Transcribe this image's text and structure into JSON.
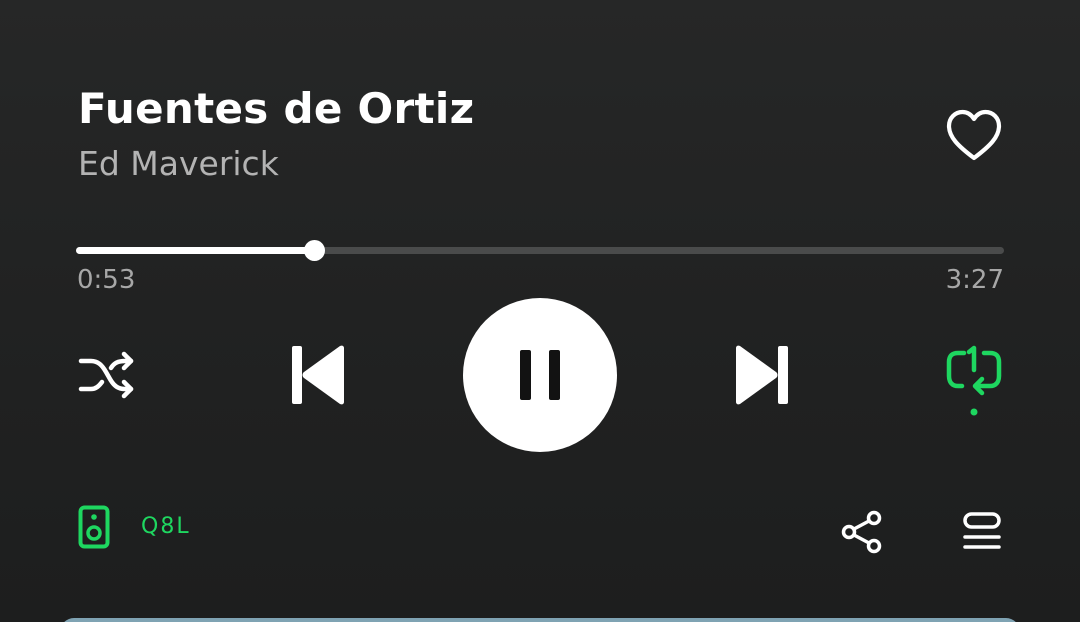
{
  "track": {
    "title": "Fuentes de Ortiz",
    "artist": "Ed Maverick",
    "liked": false
  },
  "progress": {
    "elapsed": "0:53",
    "total": "3:27",
    "fraction": 0.256
  },
  "controls": {
    "shuffle_icon": "shuffle-icon",
    "previous_icon": "skip-previous-icon",
    "play_state_icon": "pause-icon",
    "next_icon": "skip-next-icon",
    "repeat_icon": "repeat-one-icon",
    "repeat_mode": "one"
  },
  "device": {
    "icon": "speaker-icon",
    "name": "Q8L"
  },
  "actions": {
    "share_icon": "share-icon",
    "queue_icon": "queue-icon"
  },
  "colors": {
    "background": "#242525",
    "accent": "#1ed760",
    "text_primary": "#ffffff",
    "text_secondary": "#b3b3b3",
    "track_bg": "#4a4b4b"
  }
}
